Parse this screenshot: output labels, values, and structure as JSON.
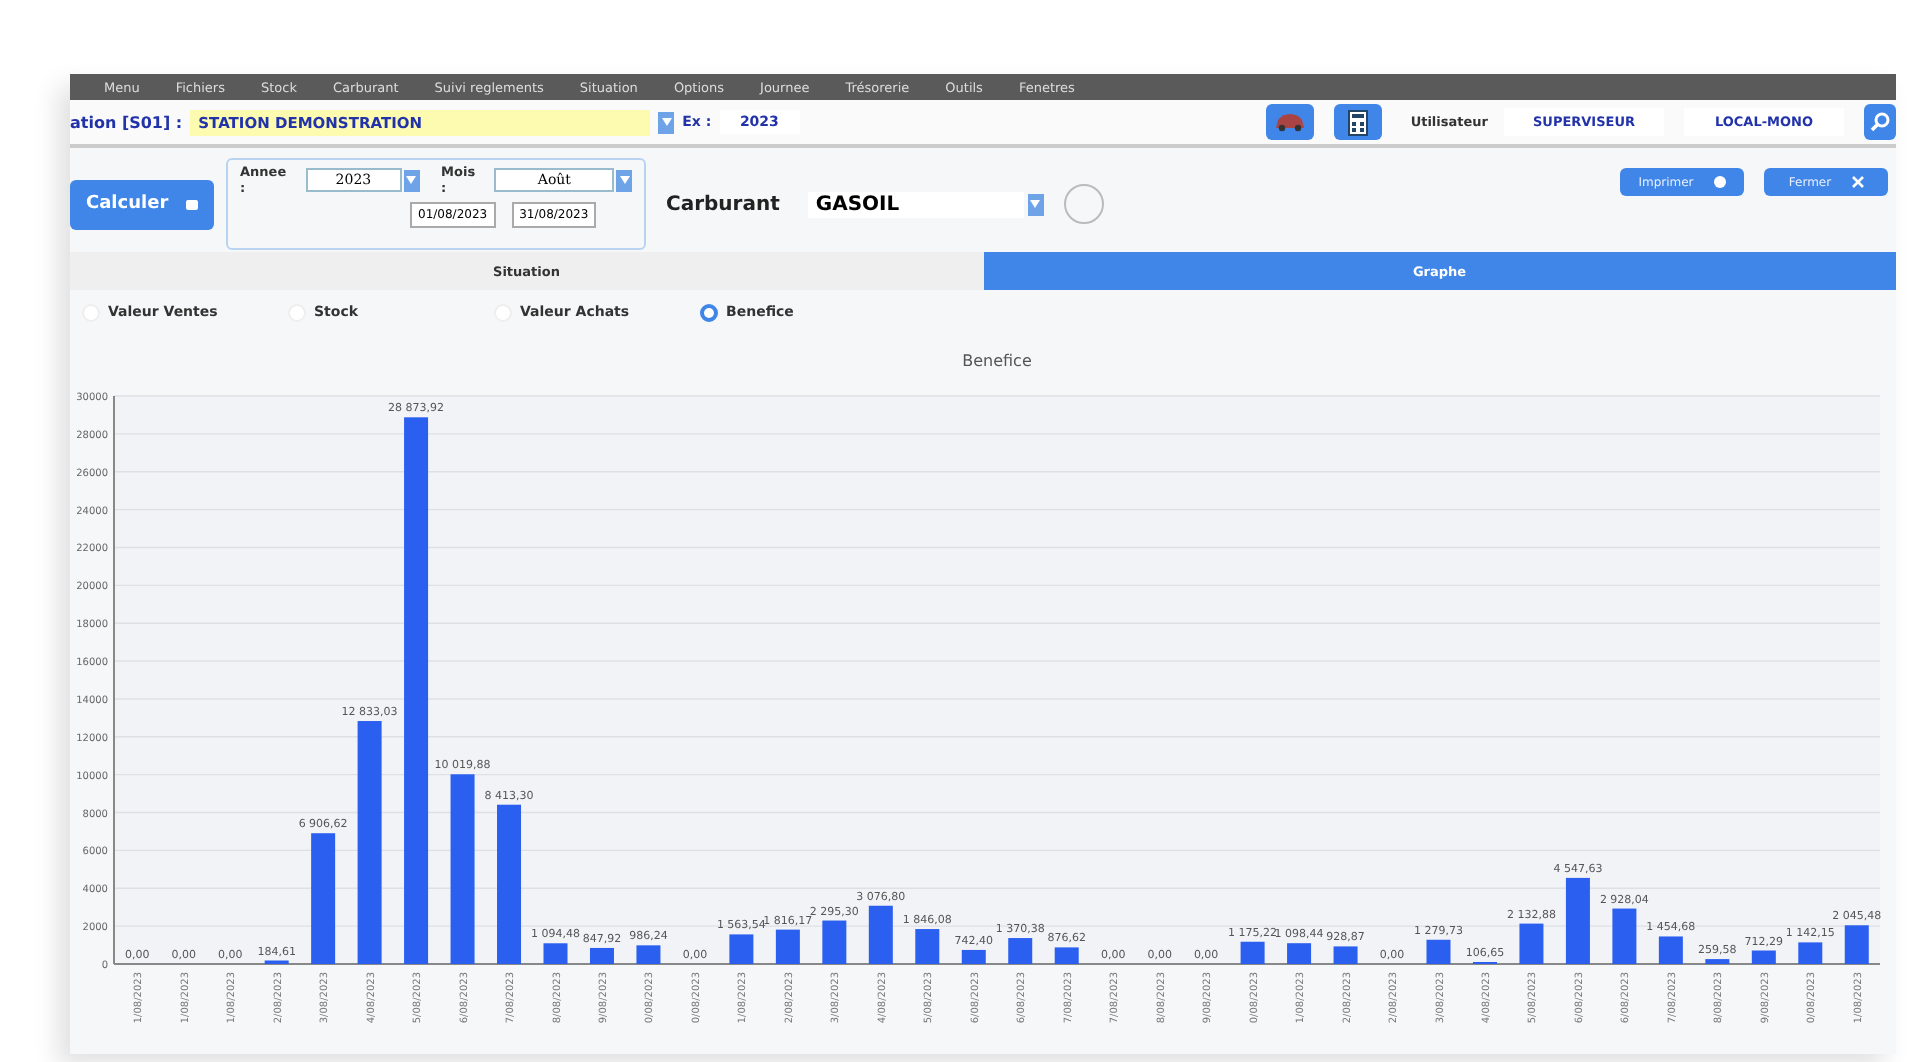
{
  "menu": [
    "Menu",
    "Fichiers",
    "Stock",
    "Carburant",
    "Suivi reglements",
    "Situation",
    "Options",
    "Journee",
    "Trésorerie",
    "Outils",
    "Fenetres"
  ],
  "station": {
    "label": "ation [S01] :",
    "value": "STATION DEMONSTRATION"
  },
  "exercise": {
    "label": "Ex :",
    "value": "2023"
  },
  "user": {
    "label": "Utilisateur",
    "name": "SUPERVISEUR",
    "mode": "LOCAL-MONO"
  },
  "calculate_button": "Calculer",
  "year": {
    "label": "Annee :",
    "value": "2023"
  },
  "month": {
    "label": "Mois :",
    "value": "Août"
  },
  "date_from": "01/08/2023",
  "date_to": "31/08/2023",
  "fuel": {
    "label": "Carburant",
    "value": "GASOIL"
  },
  "buttons": [
    {
      "label": "Imprimer",
      "kind": "print"
    },
    {
      "label": "Fermer",
      "kind": "close"
    }
  ],
  "tabs": [
    {
      "label": "Situation",
      "selected": false
    },
    {
      "label": "Graphe",
      "selected": true
    }
  ],
  "options": [
    {
      "label": "Valeur Ventes",
      "selected": false
    },
    {
      "label": "Stock",
      "selected": false
    },
    {
      "label": "Valeur Achats",
      "selected": false
    },
    {
      "label": "Benefice",
      "selected": true
    }
  ],
  "chart_data": {
    "type": "bar",
    "title": "Benefice",
    "categories": [
      "1/08/2023",
      "1/08/2023",
      "1/08/2023",
      "2/08/2023",
      "3/08/2023",
      "4/08/2023",
      "5/08/2023",
      "6/08/2023",
      "7/08/2023",
      "8/08/2023",
      "9/08/2023",
      "0/08/2023",
      "0/08/2023",
      "1/08/2023",
      "2/08/2023",
      "3/08/2023",
      "4/08/2023",
      "5/08/2023",
      "6/08/2023",
      "6/08/2023",
      "7/08/2023",
      "7/08/2023",
      "8/08/2023",
      "9/08/2023",
      "0/08/2023",
      "1/08/2023",
      "2/08/2023",
      "2/08/2023",
      "3/08/2023",
      "4/08/2023",
      "5/08/2023",
      "6/08/2023",
      "6/08/2023",
      "7/08/2023",
      "8/08/2023",
      "9/08/2023",
      "0/08/2023",
      "1/08/2023"
    ],
    "grid": true,
    "values": [
      0,
      0,
      0,
      184.61,
      6906.62,
      12833.03,
      28873.92,
      10019.88,
      8413.3,
      1094.48,
      847.92,
      986.24,
      0,
      1563.54,
      1816.17,
      2295.3,
      3076.8,
      1846.08,
      742.4,
      1370.38,
      876.62,
      0,
      0,
      0,
      1175.22,
      1098.44,
      928.87,
      0,
      1279.73,
      106.65,
      2132.88,
      4547.63,
      2928.04,
      1454.68,
      259.58,
      712.29,
      1142.15,
      2045.48
    ],
    "value_labels": [
      "0,00",
      "0,00",
      "0,00",
      "184,61",
      "6 906,62",
      "12 833,03",
      "28 873,92",
      "10 019,88",
      "8 413,30",
      "1 094,48",
      "847,92",
      "986,24",
      "0,00",
      "1 563,54",
      "1 816,17",
      "2 295,30",
      "3 076,80",
      "1 846,08",
      "742,40",
      "1 370,38",
      "876,62",
      "0,00",
      "0,00",
      "0,00",
      "1 175,22",
      "1 098,44",
      "928,87",
      "0,00",
      "1 279,73",
      "106,65",
      "2 132,88",
      "4 547,63",
      "2 928,04",
      "1 454,68",
      "259,58",
      "712,29",
      "1 142,15",
      "2 045,48"
    ],
    "ylim": [
      0,
      30000
    ],
    "yticks": [
      0,
      2000,
      4000,
      6000,
      8000,
      10000,
      12000,
      14000,
      16000,
      18000,
      20000,
      22000,
      24000,
      26000,
      28000,
      30000
    ]
  }
}
